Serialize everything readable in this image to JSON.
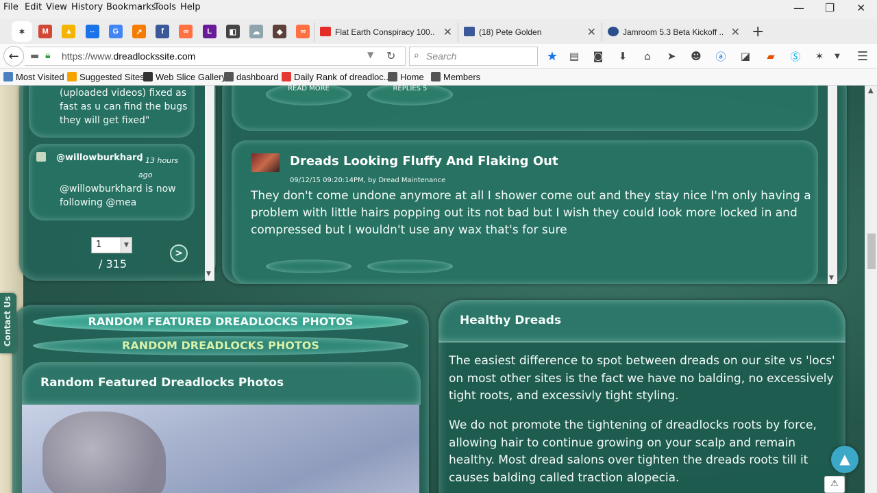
{
  "menubar": {
    "items": [
      "File",
      "Edit",
      "View",
      "History",
      "Bookmarks",
      "Tools",
      "Help"
    ]
  },
  "window_controls": {
    "minimize": "—",
    "restore": "❐",
    "close": "✕"
  },
  "tabs": [
    {
      "title": "Flat Earth Conspiracy 100...",
      "favicon_color": "#e52d27"
    },
    {
      "title": "(18) Pete Golden",
      "favicon_color": "#3b5998"
    },
    {
      "title": "Jamroom 5.3 Beta Kickoff ...",
      "favicon_color": "#2a4f8a"
    }
  ],
  "pinned_tabs": [
    {
      "icon": "dreadlocks-icon",
      "color": "#333333",
      "glyph": "✶"
    },
    {
      "icon": "gmail-icon",
      "color": "#d14836",
      "glyph": "M"
    },
    {
      "icon": "drive-icon",
      "color": "#f4b400",
      "glyph": "▲"
    },
    {
      "icon": "teamviewer-icon",
      "color": "#1a73e8",
      "glyph": "⇔"
    },
    {
      "icon": "google-icon",
      "color": "#4285f4",
      "glyph": "G"
    },
    {
      "icon": "analytics-icon",
      "color": "#f57c00",
      "glyph": "↗"
    },
    {
      "icon": "facebook-icon",
      "color": "#3b5998",
      "glyph": "f"
    },
    {
      "icon": "link-icon",
      "color": "#ff7043",
      "glyph": "∞"
    },
    {
      "icon": "letter-l-icon",
      "color": "#6a1b9a",
      "glyph": "L"
    },
    {
      "icon": "photo-icon",
      "color": "#444444",
      "glyph": "◧"
    },
    {
      "icon": "cloud-icon",
      "color": "#90a4ae",
      "glyph": "☁"
    },
    {
      "icon": "game-icon",
      "color": "#5d4037",
      "glyph": "◆"
    },
    {
      "icon": "link2-icon",
      "color": "#ff7043",
      "glyph": "∞"
    }
  ],
  "navbar": {
    "url_prefix": "https://www.",
    "url_domain": "dreadlockssite.com",
    "search_placeholder": "Search"
  },
  "bookmarks": [
    {
      "label": "Most Visited",
      "color": "#4a7fc1"
    },
    {
      "label": "Suggested Sites",
      "color": "#f4a300"
    },
    {
      "label": "Web Slice Gallery",
      "color": "#333333"
    },
    {
      "label": "dashboard",
      "color": "#555555"
    },
    {
      "label": "Daily Rank of dreadloc...",
      "color": "#e53935"
    },
    {
      "label": "Home",
      "color": "#555555"
    },
    {
      "label": "Members",
      "color": "#555555"
    }
  ],
  "sidebar_feed": {
    "top_text": "(uploaded videos) fixed as fast as u can find the bugs they will get fixed\"",
    "item": {
      "user": "@willowburkhard",
      "time": "• 13 hours ago",
      "message_user": "@willowburkhard",
      "message_mid": " is now following ",
      "message_target": "@mea"
    },
    "pager": {
      "page": "1",
      "total": "/ 315",
      "next": ">"
    }
  },
  "contact_tab": "Contact Us",
  "forum": {
    "prev_buttons": {
      "read_more": "READ MORE",
      "replies": "REPLIES 5"
    },
    "post": {
      "title": "Dreads Looking Fluffy And Flaking Out",
      "meta_date": "09/12/15 09:20:14PM, by ",
      "meta_author": "Dread Maintenance",
      "body": "They don't come undone anymore at all I shower come out and they stay nice I'm only having a problem with little hairs popping out its not bad but I wish they could look more locked in and compressed but I wouldn't use any wax that's for sure"
    }
  },
  "photos": {
    "tab_featured": "RANDOM FEATURED DREADLOCKS PHOTOS",
    "tab_random": "RANDOM DREADLOCKS PHOTOS",
    "heading": "Random Featured Dreadlocks Photos"
  },
  "healthy": {
    "heading": "Healthy Dreads",
    "para1": "The easiest difference to spot between dreads on our site vs 'locs' on most other sites is the fact we have no balding, no excessively tight roots, and excessivly tight styling.",
    "para2": "We do not promote the tightening of dreadlocks roots by force, allowing hair to continue growing on your scalp and remain healthy. Most dread salons over tighten the dreads roots till it causes balding called traction alopecia."
  },
  "colors": {
    "accent_text": "#ffffff",
    "featured_tab_text": "#f3fbf8",
    "random_tab_text": "#d9f0a8",
    "page_bg": "#28594d"
  }
}
